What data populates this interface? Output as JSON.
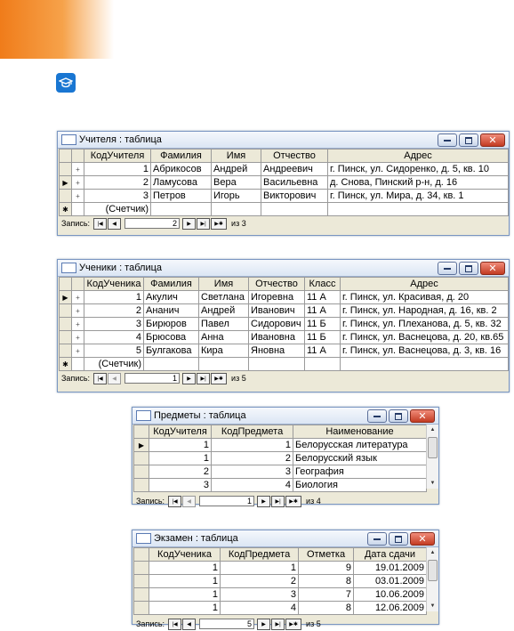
{
  "teachers": {
    "title": "Учителя : таблица",
    "headers": [
      "КодУчителя",
      "Фамилия",
      "Имя",
      "Отчество",
      "Адрес"
    ],
    "rows": [
      {
        "marker": "",
        "plus": "+",
        "cells": [
          "1",
          "Абрикосов",
          "Андрей",
          "Андреевич",
          "г. Пинск, ул. Сидоренко, д. 5, кв. 10"
        ]
      },
      {
        "marker": "▶",
        "plus": "+",
        "cells": [
          "2",
          "Ламусова",
          "Вера",
          "Васильевна",
          "д. Снова, Пинский р-н, д. 16"
        ]
      },
      {
        "marker": "",
        "plus": "+",
        "cells": [
          "3",
          "Петров",
          "Игорь",
          "Викторович",
          "г. Пинск, ул. Мира, д. 34, кв. 1"
        ]
      }
    ],
    "new_marker": "✱",
    "counter": "(Счетчик)",
    "nav": {
      "label": "Запись:",
      "current": "2",
      "total_text": "из 3"
    }
  },
  "students": {
    "title": "Ученики : таблица",
    "headers": [
      "КодУченика",
      "Фамилия",
      "Имя",
      "Отчество",
      "Класс",
      "Адрес"
    ],
    "rows": [
      {
        "marker": "▶",
        "plus": "+",
        "cells": [
          "1",
          "Акулич",
          "Светлана",
          "Игоревна",
          "11 А",
          "г. Пинск, ул. Красивая, д. 20"
        ]
      },
      {
        "marker": "",
        "plus": "+",
        "cells": [
          "2",
          "Ананич",
          "Андрей",
          "Иванович",
          "11 А",
          "г. Пинск, ул. Народная, д. 16, кв. 2"
        ]
      },
      {
        "marker": "",
        "plus": "+",
        "cells": [
          "3",
          "Бирюров",
          "Павел",
          "Сидорович",
          "11 Б",
          "г. Пинск, ул. Плеханова, д. 5, кв. 32"
        ]
      },
      {
        "marker": "",
        "plus": "+",
        "cells": [
          "4",
          "Брюсова",
          "Анна",
          "Ивановна",
          "11 Б",
          "г. Пинск, ул. Васнецова, д. 20, кв.65"
        ]
      },
      {
        "marker": "",
        "plus": "+",
        "cells": [
          "5",
          "Булгакова",
          "Кира",
          "Яновна",
          "11 А",
          "г. Пинск, ул. Васнецова, д. 3, кв. 16"
        ]
      }
    ],
    "new_marker": "✱",
    "counter": "(Счетчик)",
    "nav": {
      "label": "Запись:",
      "current": "1",
      "total_text": "из 5"
    }
  },
  "subjects": {
    "title": "Предметы : таблица",
    "headers": [
      "КодУчителя",
      "КодПредмета",
      "Наименование"
    ],
    "rows": [
      {
        "marker": "▶",
        "cells": [
          "1",
          "1",
          "Белорусская литература"
        ]
      },
      {
        "marker": "",
        "cells": [
          "1",
          "2",
          "Белорусский язык"
        ]
      },
      {
        "marker": "",
        "cells": [
          "2",
          "3",
          "География"
        ]
      },
      {
        "marker": "",
        "cells": [
          "3",
          "4",
          "Биология"
        ]
      }
    ],
    "nav": {
      "label": "Запись:",
      "current": "1",
      "total_text": "из 4"
    }
  },
  "exams": {
    "title": "Экзамен : таблица",
    "headers": [
      "КодУченика",
      "КодПредмета",
      "Отметка",
      "Дата сдачи"
    ],
    "rows": [
      {
        "marker": "",
        "cells": [
          "1",
          "1",
          "9",
          "19.01.2009"
        ]
      },
      {
        "marker": "",
        "cells": [
          "1",
          "2",
          "8",
          "03.01.2009"
        ]
      },
      {
        "marker": "",
        "cells": [
          "1",
          "3",
          "7",
          "10.06.2009"
        ]
      },
      {
        "marker": "",
        "cells": [
          "1",
          "4",
          "8",
          "12.06.2009"
        ]
      }
    ],
    "nav": {
      "label": "Запись:",
      "current": "5",
      "total_text": "из 5"
    }
  },
  "icons": {
    "close": "✕",
    "nav_first": "|◀",
    "nav_prev": "◀",
    "nav_next": "▶",
    "nav_last": "▶|",
    "nav_new": "▶✱",
    "scroll_up": "▲",
    "scroll_down": "▼"
  },
  "colors": {
    "accent_orange": "#f07c1a",
    "icon_blue": "#1976d2",
    "close_red": "#c33b22"
  }
}
